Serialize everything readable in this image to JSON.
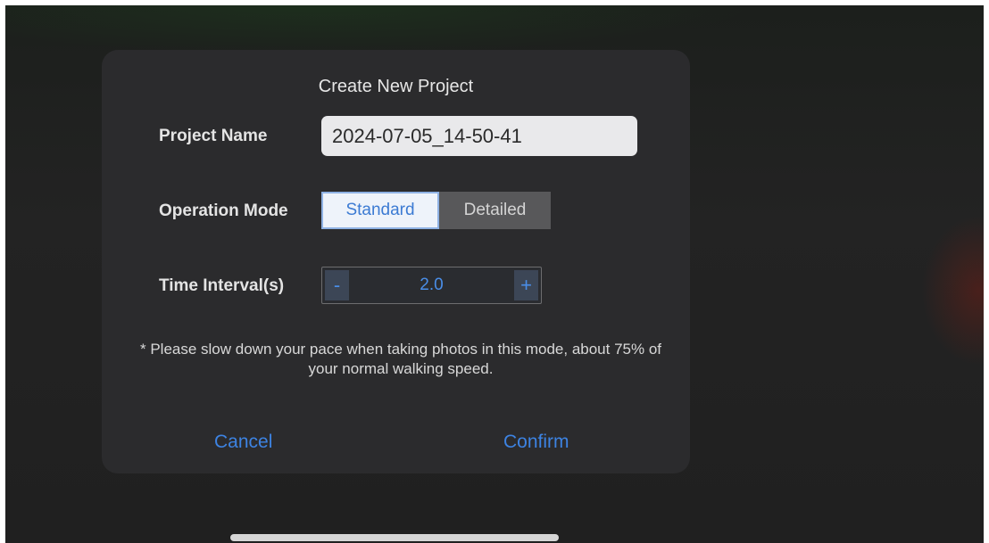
{
  "dialog": {
    "title": "Create New Project",
    "project_name": {
      "label": "Project Name",
      "value": "2024-07-05_14-50-41"
    },
    "operation_mode": {
      "label": "Operation Mode",
      "options": [
        "Standard",
        "Detailed"
      ],
      "selected": "Standard"
    },
    "time_interval": {
      "label": "Time Interval(s)",
      "decrement": "-",
      "value": "2.0",
      "increment": "+"
    },
    "note": "* Please slow down your pace when taking photos in this mode, about 75% of your normal walking speed.",
    "cancel": "Cancel",
    "confirm": "Confirm"
  },
  "colors": {
    "accent": "#3d83e2",
    "dialog_bg": "#2b2b2d",
    "selected_segment_bg": "#eef3fa",
    "unselected_segment_bg": "#58585a"
  }
}
